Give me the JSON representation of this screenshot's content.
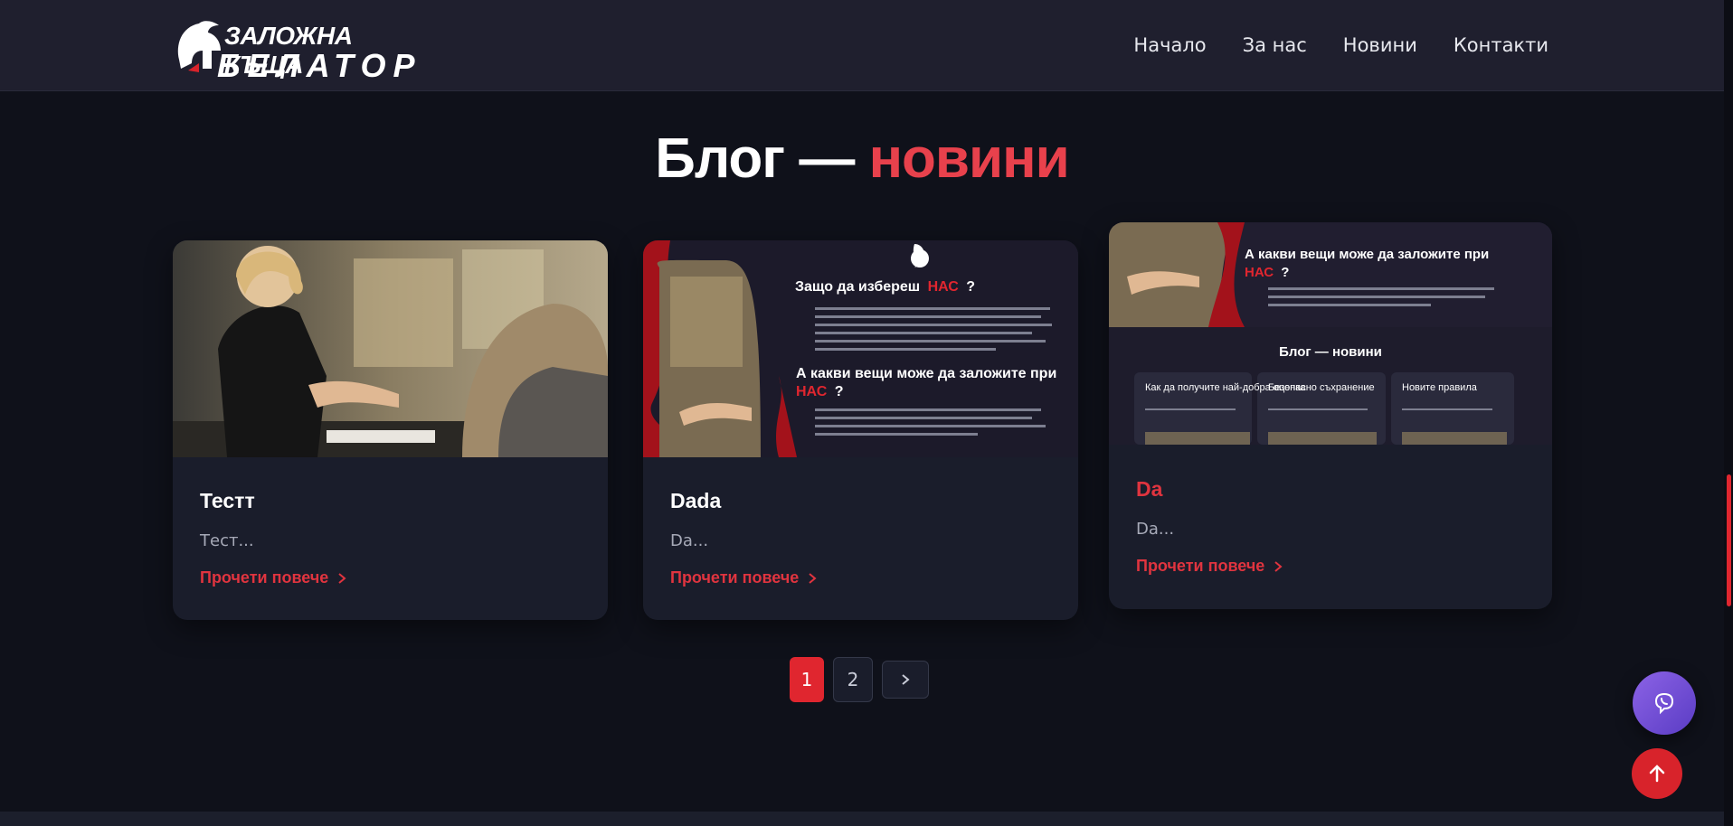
{
  "header": {
    "logo_line1": "ЗАЛОЖНА КЪЩА",
    "logo_line2": "БЕЛАТОР",
    "nav": [
      {
        "label": "Начало"
      },
      {
        "label": "За нас"
      },
      {
        "label": "Новини"
      },
      {
        "label": "Контакти"
      }
    ]
  },
  "section": {
    "title_main": "Блог —",
    "title_accent": "новини"
  },
  "cards": [
    {
      "title": "Тестт",
      "excerpt": "Тест...",
      "link_label": "Прочети повече"
    },
    {
      "title": "Dada",
      "excerpt": "Da...",
      "link_label": "Прочети повече",
      "image_heading1_prefix": "Защо да избереш",
      "image_heading1_accent": "НАС",
      "image_heading1_suffix": "?",
      "image_heading2_prefix": "А какви вещи може да заложите при",
      "image_heading2_accent": "НАС",
      "image_heading2_suffix": "?"
    },
    {
      "title": "Da",
      "excerpt": "Da...",
      "link_label": "Прочети повече",
      "image_heading_prefix": "А какви вещи може да заложите при",
      "image_heading_accent": "НАС",
      "image_heading_suffix": "?",
      "image_blog_title": "Блог — новини",
      "image_mini_cards": [
        "Как да получите най-добра оценка",
        "Безопасно съхранение",
        "Новите правила"
      ]
    }
  ],
  "pagination": {
    "pages": [
      "1",
      "2"
    ],
    "active": "1"
  },
  "colors": {
    "accent": "#e0262f",
    "background": "#0f111a",
    "card": "#1a1d2b",
    "header": "#1f1f2e",
    "viber": "#7b55dc"
  },
  "icons": {
    "next": "chevron-right-icon",
    "viber": "viber-icon",
    "to_top": "arrow-up-icon"
  }
}
